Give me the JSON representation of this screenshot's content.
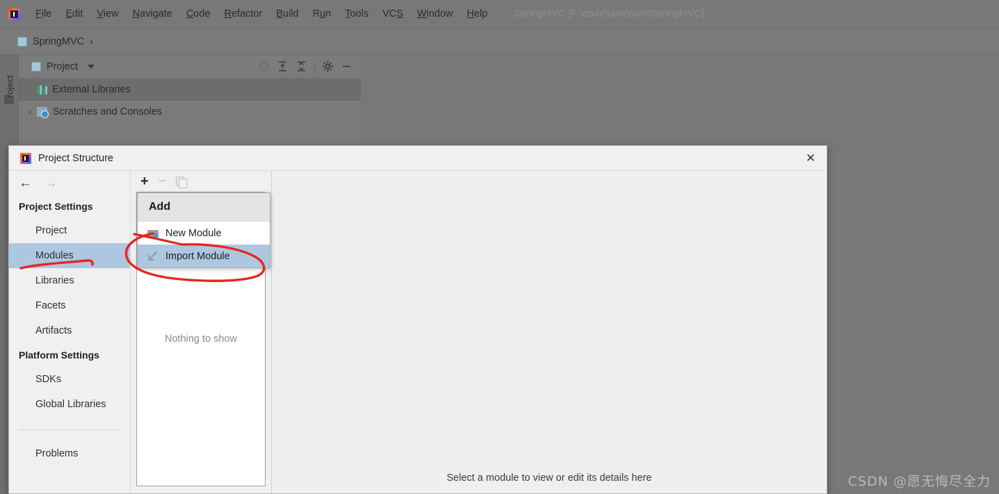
{
  "ide": {
    "logo_icon": "intellij-logo-icon",
    "menubar": [
      {
        "label": "File",
        "mnemonic": "F"
      },
      {
        "label": "Edit",
        "mnemonic": "E"
      },
      {
        "label": "View",
        "mnemonic": "V"
      },
      {
        "label": "Navigate",
        "mnemonic": "N"
      },
      {
        "label": "Code",
        "mnemonic": "C"
      },
      {
        "label": "Refactor",
        "mnemonic": "R"
      },
      {
        "label": "Build",
        "mnemonic": "B"
      },
      {
        "label": "Run",
        "mnemonic": "u"
      },
      {
        "label": "Tools",
        "mnemonic": "T"
      },
      {
        "label": "VCS",
        "mnemonic": "S"
      },
      {
        "label": "Window",
        "mnemonic": "W"
      },
      {
        "label": "Help",
        "mnemonic": "H"
      }
    ],
    "window_title": "SpringMVC [F:\\code\\java\\ssm\\SpringMVC]",
    "breadcrumb": {
      "icon": "module-icon",
      "text": "SpringMVC",
      "separator": "›"
    },
    "tool_strip": {
      "project_tab": "Project",
      "folder_icon": "folder-icon"
    },
    "project_panel": {
      "title": "Project",
      "caret_icon": "chevron-down-icon",
      "tools": [
        {
          "icon": "locate-icon"
        },
        {
          "icon": "expand-all-icon"
        },
        {
          "icon": "collapse-all-icon"
        },
        {
          "icon": "gear-icon"
        },
        {
          "icon": "hide-icon"
        }
      ],
      "tree": [
        {
          "label": "External Libraries",
          "icon": "libraries-icon",
          "selected": true,
          "arrow": ""
        },
        {
          "label": "Scratches and Consoles",
          "icon": "scratches-icon",
          "selected": false,
          "arrow": "›"
        }
      ]
    }
  },
  "dialog": {
    "title": "Project Structure",
    "logo_icon": "intellij-logo-icon",
    "close_icon": "close-icon",
    "nav": {
      "back_icon": "arrow-left-icon",
      "forward_icon": "arrow-right-icon"
    },
    "sidebar": {
      "groups": [
        {
          "title": "Project Settings",
          "items": [
            {
              "label": "Project",
              "selected": false
            },
            {
              "label": "Modules",
              "selected": true
            },
            {
              "label": "Libraries",
              "selected": false
            },
            {
              "label": "Facets",
              "selected": false
            },
            {
              "label": "Artifacts",
              "selected": false
            }
          ]
        },
        {
          "title": "Platform Settings",
          "items": [
            {
              "label": "SDKs",
              "selected": false
            },
            {
              "label": "Global Libraries",
              "selected": false
            }
          ]
        }
      ],
      "footer_item": {
        "label": "Problems",
        "selected": false
      }
    },
    "modules_column": {
      "toolbar": [
        {
          "icon": "plus-icon",
          "enabled": true
        },
        {
          "icon": "minus-icon",
          "enabled": false
        },
        {
          "icon": "copy-icon",
          "enabled": false
        }
      ],
      "empty_text": "Nothing to show"
    },
    "add_popup": {
      "title": "Add",
      "items": [
        {
          "label": "New Module",
          "icon": "new-module-folder-icon",
          "highlighted": false
        },
        {
          "label": "Import Module",
          "icon": "import-module-icon",
          "highlighted": true
        }
      ]
    },
    "detail_pane": {
      "hint": "Select a module to view or edit its details here"
    }
  },
  "annotations": {
    "color": "#e8261c",
    "shapes": [
      "underline-under-modules",
      "ellipse-around-import-module",
      "stroke-through-new-module"
    ]
  },
  "watermark": {
    "text": "CSDN @愿无悔尽全力"
  }
}
